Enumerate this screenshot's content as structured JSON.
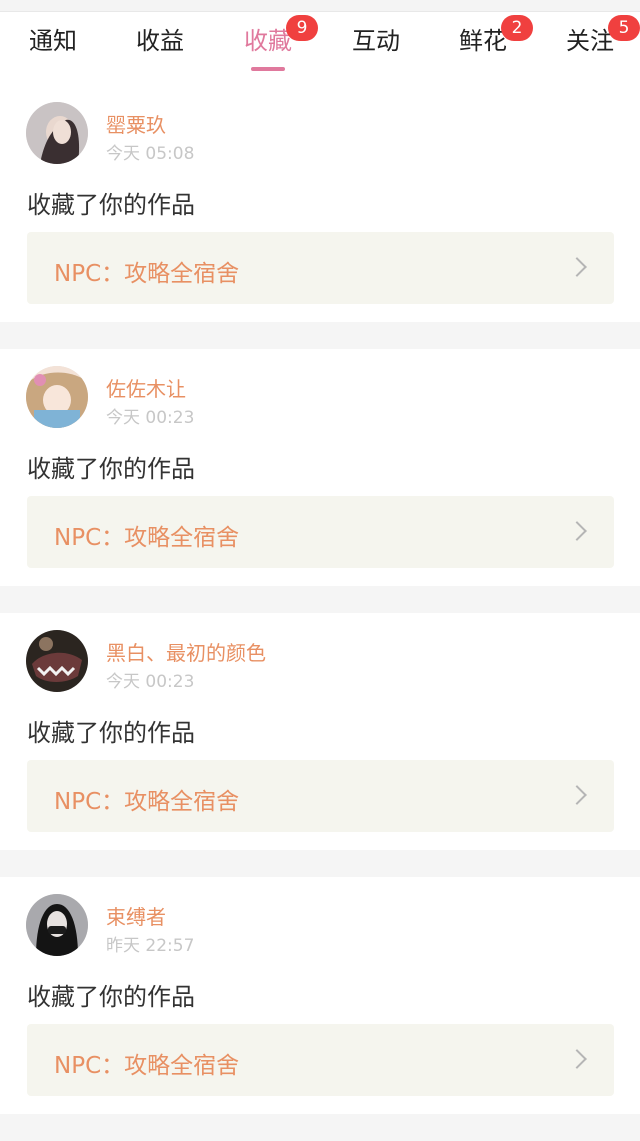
{
  "tabs": [
    {
      "label": "通知",
      "badge": null,
      "active": false
    },
    {
      "label": "收益",
      "badge": null,
      "active": false
    },
    {
      "label": "收藏",
      "badge": "9",
      "active": true
    },
    {
      "label": "互动",
      "badge": null,
      "active": false
    },
    {
      "label": "鲜花",
      "badge": "2",
      "active": false
    },
    {
      "label": "关注",
      "badge": "5",
      "active": false
    }
  ],
  "items": [
    {
      "name": "罂粟玖",
      "time": "今天 05:08",
      "action": "收藏了你的作品",
      "work": "NPC：攻略全宿舍"
    },
    {
      "name": "佐佐木让",
      "time": "今天 00:23",
      "action": "收藏了你的作品",
      "work": "NPC：攻略全宿舍"
    },
    {
      "name": "黑白、最初的颜色",
      "time": "今天 00:23",
      "action": "收藏了你的作品",
      "work": "NPC：攻略全宿舍"
    },
    {
      "name": "束缚者",
      "time": "昨天 22:57",
      "action": "收藏了你的作品",
      "work": "NPC：攻略全宿舍"
    }
  ],
  "colors": {
    "accent": "#e0799d",
    "name": "#e89063",
    "badge": "#f0403f"
  }
}
